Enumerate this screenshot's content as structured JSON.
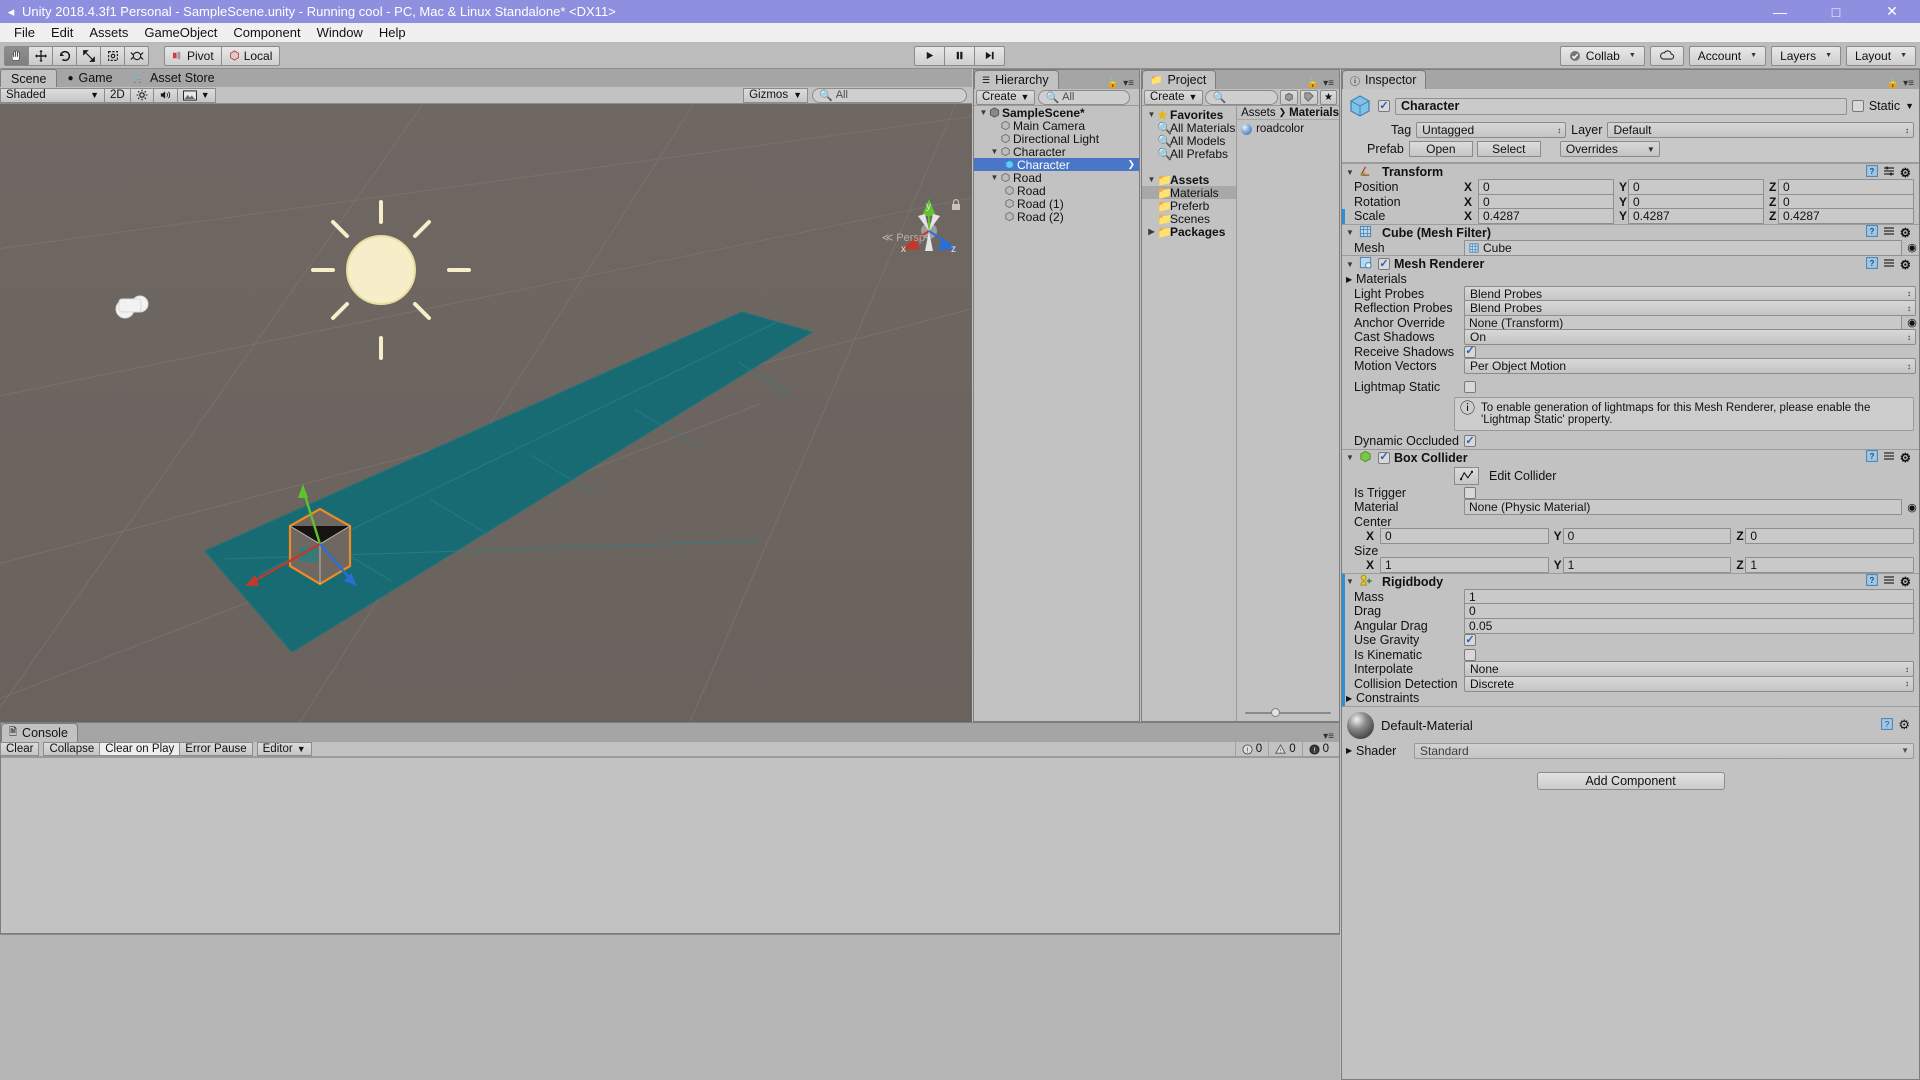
{
  "window": {
    "title": "Unity 2018.4.3f1 Personal - SampleScene.unity - Running cool - PC, Mac & Linux Standalone* <DX11>",
    "minimize": "—",
    "maximize": "□",
    "close": "✕"
  },
  "menubar": {
    "items": [
      "File",
      "Edit",
      "Assets",
      "GameObject",
      "Component",
      "Window",
      "Help"
    ]
  },
  "toolbar": {
    "tools": [
      "hand-tool",
      "move-tool",
      "rotate-tool",
      "scale-tool",
      "rect-tool",
      "transform-tool"
    ],
    "pivot_label": "Pivot",
    "local_label": "Local",
    "play_label": "▶",
    "pause_label": "❙❙",
    "step_label": "▶❙",
    "collab_label": "Collab",
    "cloud_label": "cloud-icon",
    "account_label": "Account",
    "layers_label": "Layers",
    "layout_label": "Layout"
  },
  "scene": {
    "tabs": [
      {
        "label": "Scene",
        "icon": "scene-icon",
        "active": true
      },
      {
        "label": "Game",
        "icon": "game-icon",
        "active": false
      },
      {
        "label": "Asset Store",
        "icon": "store-icon",
        "active": false
      }
    ],
    "shading_mode": "Shaded",
    "mode_2d": "2D",
    "lighting_icon": "sun-icon",
    "audio_icon": "speaker-icon",
    "fx_icon": "image-icon",
    "gizmos_label": "Gizmos",
    "search_placeholder": "All",
    "projection_label": "Persp",
    "axis_x": "x",
    "axis_y": "y",
    "axis_z": "z"
  },
  "hierarchy": {
    "tab_label": "Hierarchy",
    "create_label": "Create",
    "search_placeholder": "All",
    "items": [
      {
        "label": "SampleScene*",
        "depth": 0,
        "twisty": "▼",
        "icon": "unity-icon",
        "bold": true,
        "selected": false
      },
      {
        "label": "Main Camera",
        "depth": 1,
        "twisty": "",
        "icon": "gameobject-icon",
        "bold": false,
        "selected": false
      },
      {
        "label": "Directional Light",
        "depth": 1,
        "twisty": "",
        "icon": "gameobject-icon",
        "bold": false,
        "selected": false
      },
      {
        "label": "Character",
        "depth": 1,
        "twisty": "▼",
        "icon": "gameobject-icon",
        "bold": false,
        "selected": false
      },
      {
        "label": "Character",
        "depth": 2,
        "twisty": "",
        "icon": "prefab-icon",
        "bold": false,
        "selected": true
      },
      {
        "label": "Road",
        "depth": 1,
        "twisty": "▼",
        "icon": "gameobject-icon",
        "bold": false,
        "selected": false
      },
      {
        "label": "Road",
        "depth": 2,
        "twisty": "",
        "icon": "gameobject-icon",
        "bold": false,
        "selected": false
      },
      {
        "label": "Road (1)",
        "depth": 2,
        "twisty": "",
        "icon": "gameobject-icon",
        "bold": false,
        "selected": false
      },
      {
        "label": "Road (2)",
        "depth": 2,
        "twisty": "",
        "icon": "gameobject-icon",
        "bold": false,
        "selected": false
      }
    ]
  },
  "project": {
    "tab_label": "Project",
    "create_label": "Create",
    "search_placeholder": "",
    "tree": [
      {
        "label": "Favorites",
        "depth": 0,
        "twisty": "▼",
        "icon": "star-icon",
        "bold": true,
        "selected": false
      },
      {
        "label": "All Materials",
        "depth": 1,
        "twisty": "",
        "icon": "search-icon",
        "bold": false,
        "selected": false
      },
      {
        "label": "All Models",
        "depth": 1,
        "twisty": "",
        "icon": "search-icon",
        "bold": false,
        "selected": false
      },
      {
        "label": "All Prefabs",
        "depth": 1,
        "twisty": "",
        "icon": "search-icon",
        "bold": false,
        "selected": false
      },
      {
        "label": "",
        "depth": 0,
        "twisty": "",
        "icon": "",
        "bold": false,
        "selected": false
      },
      {
        "label": "Assets",
        "depth": 0,
        "twisty": "▼",
        "icon": "folder-icon",
        "bold": true,
        "selected": false
      },
      {
        "label": "Materials",
        "depth": 1,
        "twisty": "",
        "icon": "folder-icon",
        "bold": false,
        "selected": true
      },
      {
        "label": "Preferb",
        "depth": 1,
        "twisty": "",
        "icon": "folder-icon",
        "bold": false,
        "selected": false
      },
      {
        "label": "Scenes",
        "depth": 1,
        "twisty": "",
        "icon": "folder-icon",
        "bold": false,
        "selected": false
      },
      {
        "label": "Packages",
        "depth": 0,
        "twisty": "▶",
        "icon": "folder-icon",
        "bold": true,
        "selected": false
      }
    ],
    "breadcrumb": [
      "Assets",
      "Materials"
    ],
    "assets": [
      {
        "label": "roadcolor",
        "icon": "material-icon"
      }
    ]
  },
  "inspector": {
    "tab_label": "Inspector",
    "object_name": "Character",
    "object_enabled": true,
    "static_label": "Static",
    "static_checked": false,
    "tag_label": "Tag",
    "tag_value": "Untagged",
    "layer_label": "Layer",
    "layer_value": "Default",
    "prefab_label": "Prefab",
    "prefab_open": "Open",
    "prefab_select": "Select",
    "prefab_overrides": "Overrides",
    "transform": {
      "title": "Transform",
      "position_label": "Position",
      "position": {
        "x": "0",
        "y": "0",
        "z": "0"
      },
      "rotation_label": "Rotation",
      "rotation": {
        "x": "0",
        "y": "0",
        "z": "0"
      },
      "scale_label": "Scale",
      "scale": {
        "x": "0.4287",
        "y": "0.4287",
        "z": "0.4287"
      }
    },
    "mesh_filter": {
      "title": "Cube (Mesh Filter)",
      "mesh_label": "Mesh",
      "mesh_value": "Cube"
    },
    "mesh_renderer": {
      "title": "Mesh Renderer",
      "enabled": true,
      "materials_label": "Materials",
      "light_probes_label": "Light Probes",
      "light_probes_value": "Blend Probes",
      "reflection_probes_label": "Reflection Probes",
      "reflection_probes_value": "Blend Probes",
      "anchor_override_label": "Anchor Override",
      "anchor_override_value": "None (Transform)",
      "cast_shadows_label": "Cast Shadows",
      "cast_shadows_value": "On",
      "receive_shadows_label": "Receive Shadows",
      "receive_shadows_checked": true,
      "motion_vectors_label": "Motion Vectors",
      "motion_vectors_value": "Per Object Motion",
      "lightmap_static_label": "Lightmap Static",
      "lightmap_static_checked": false,
      "help_text": "To enable generation of lightmaps for this Mesh Renderer, please enable the 'Lightmap Static' property.",
      "dynamic_occluded_label": "Dynamic Occluded",
      "dynamic_occluded_checked": true
    },
    "box_collider": {
      "title": "Box Collider",
      "enabled": true,
      "edit_collider_label": "Edit Collider",
      "is_trigger_label": "Is Trigger",
      "is_trigger_checked": false,
      "material_label": "Material",
      "material_value": "None (Physic Material)",
      "center_label": "Center",
      "center": {
        "x": "0",
        "y": "0",
        "z": "0"
      },
      "size_label": "Size",
      "size": {
        "x": "1",
        "y": "1",
        "z": "1"
      }
    },
    "rigidbody": {
      "title": "Rigidbody",
      "mass_label": "Mass",
      "mass_value": "1",
      "drag_label": "Drag",
      "drag_value": "0",
      "angular_drag_label": "Angular Drag",
      "angular_drag_value": "0.05",
      "use_gravity_label": "Use Gravity",
      "use_gravity_checked": true,
      "is_kinematic_label": "Is Kinematic",
      "is_kinematic_checked": false,
      "interpolate_label": "Interpolate",
      "interpolate_value": "None",
      "collision_detection_label": "Collision Detection",
      "collision_detection_value": "Discrete",
      "constraints_label": "Constraints"
    },
    "material": {
      "title": "Default-Material",
      "shader_label": "Shader",
      "shader_value": "Standard"
    },
    "add_component_label": "Add Component"
  },
  "console": {
    "tab_label": "Console",
    "clear_label": "Clear",
    "collapse_label": "Collapse",
    "clear_on_play_label": "Clear on Play",
    "error_pause_label": "Error Pause",
    "editor_label": "Editor",
    "log_count": "0",
    "warn_count": "0",
    "error_count": "0"
  },
  "colors": {
    "road_teal": "#186b73",
    "selection_blue": "#4a76c8",
    "title_purple": "#8f8fe0",
    "scene_bg": "#6e6660",
    "axis_x": "#c0392b",
    "axis_y": "#5fc22e",
    "axis_z": "#2a6fd6",
    "gizmo_orange": "#f08a24"
  }
}
